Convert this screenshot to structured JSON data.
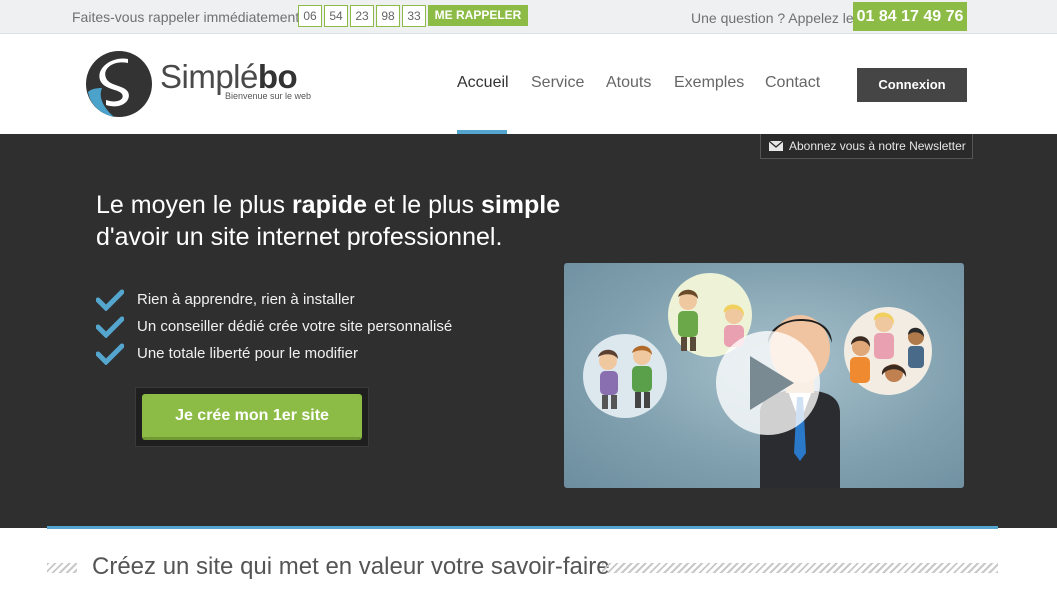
{
  "topbar": {
    "callback_text": "Faites-vous rappeler immédiatement.",
    "phone_digits": [
      "06",
      "54",
      "23",
      "98",
      "33"
    ],
    "callback_button": "ME RAPPELER",
    "question_text": "Une question ? Appelez le",
    "phone_number": "01 84 17 49 76"
  },
  "brand": {
    "name_light": "Simplé",
    "name_bold": "bo",
    "tagline": "Bienvenue sur le web"
  },
  "nav": {
    "items": [
      "Accueil",
      "Service",
      "Atouts",
      "Exemples",
      "Contact"
    ],
    "active": "Accueil",
    "login": "Connexion"
  },
  "newsletter": {
    "label": "Abonnez vous à notre Newsletter",
    "icon": "envelope-icon"
  },
  "hero": {
    "title_pre": "Le moyen le plus ",
    "title_bold1": "rapide",
    "title_mid": " et le plus ",
    "title_bold2": "simple",
    "title_line2": "d'avoir un site internet professionnel.",
    "benefits": [
      "Rien à apprendre, rien à installer",
      "Un conseiller dédié crée votre site personnalisé",
      "Une totale liberté pour le modifier"
    ],
    "cta": "Je crée mon 1er site"
  },
  "section": {
    "title": "Créez un site qui met en valeur votre savoir-faire"
  },
  "colors": {
    "accent_green": "#8cbc46",
    "accent_blue": "#55a6cf",
    "hero_bg": "#2f2f2f",
    "dark_button": "#454545"
  }
}
